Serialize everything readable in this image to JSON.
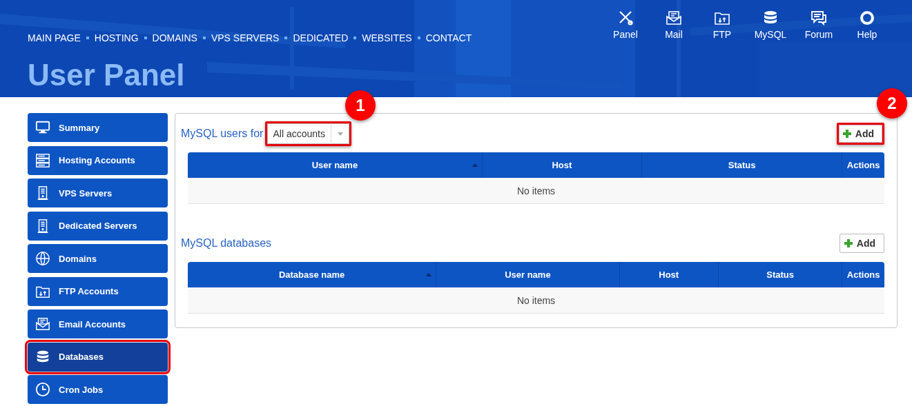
{
  "nav": {
    "links": [
      "MAIN PAGE",
      "HOSTING",
      "DOMAINS",
      "VPS SERVERS",
      "DEDICATED",
      "WEBSITES",
      "CONTACT"
    ],
    "shortcuts": [
      {
        "label": "Panel",
        "kind": "tools"
      },
      {
        "label": "Mail",
        "kind": "mail"
      },
      {
        "label": "FTP",
        "kind": "ftp"
      },
      {
        "label": "MySQL",
        "kind": "database"
      },
      {
        "label": "Forum",
        "kind": "chat"
      },
      {
        "label": "Help",
        "kind": "lifebuoy"
      }
    ]
  },
  "page_title": "User Panel",
  "sidebar": {
    "items": [
      {
        "label": "Summary",
        "kind": "monitor",
        "selected": false,
        "highlighted": false
      },
      {
        "label": "Hosting Accounts",
        "kind": "rack",
        "selected": false,
        "highlighted": false
      },
      {
        "label": "VPS Servers",
        "kind": "server",
        "selected": false,
        "highlighted": false
      },
      {
        "label": "Dedicated Servers",
        "kind": "server",
        "selected": false,
        "highlighted": false
      },
      {
        "label": "Domains",
        "kind": "globe",
        "selected": false,
        "highlighted": false
      },
      {
        "label": "FTP Accounts",
        "kind": "ftp",
        "selected": false,
        "highlighted": false
      },
      {
        "label": "Email Accounts",
        "kind": "mail",
        "selected": false,
        "highlighted": false
      },
      {
        "label": "Databases",
        "kind": "database",
        "selected": true,
        "highlighted": true
      },
      {
        "label": "Cron Jobs",
        "kind": "clock",
        "selected": false,
        "highlighted": false
      }
    ]
  },
  "sections": [
    {
      "title": "MySQL users for",
      "filter": {
        "value": "All accounts",
        "highlighted": true
      },
      "add_button": {
        "label": "Add",
        "highlighted": true
      },
      "table": {
        "columns": [
          {
            "label": "User name",
            "sorted": true
          },
          {
            "label": "Host",
            "sorted": false
          },
          {
            "label": "Status",
            "sorted": false
          },
          {
            "label": "Actions",
            "sorted": false
          }
        ],
        "empty_text": "No items"
      }
    },
    {
      "title": "MySQL databases",
      "add_button": {
        "label": "Add",
        "highlighted": false
      },
      "table": {
        "columns": [
          {
            "label": "Database name",
            "sorted": true
          },
          {
            "label": "User name",
            "sorted": false
          },
          {
            "label": "Host",
            "sorted": false
          },
          {
            "label": "Status",
            "sorted": false
          },
          {
            "label": "Actions",
            "sorted": false
          }
        ],
        "empty_text": "No items"
      }
    }
  ],
  "markers": [
    {
      "label": "1"
    },
    {
      "label": "2"
    }
  ]
}
